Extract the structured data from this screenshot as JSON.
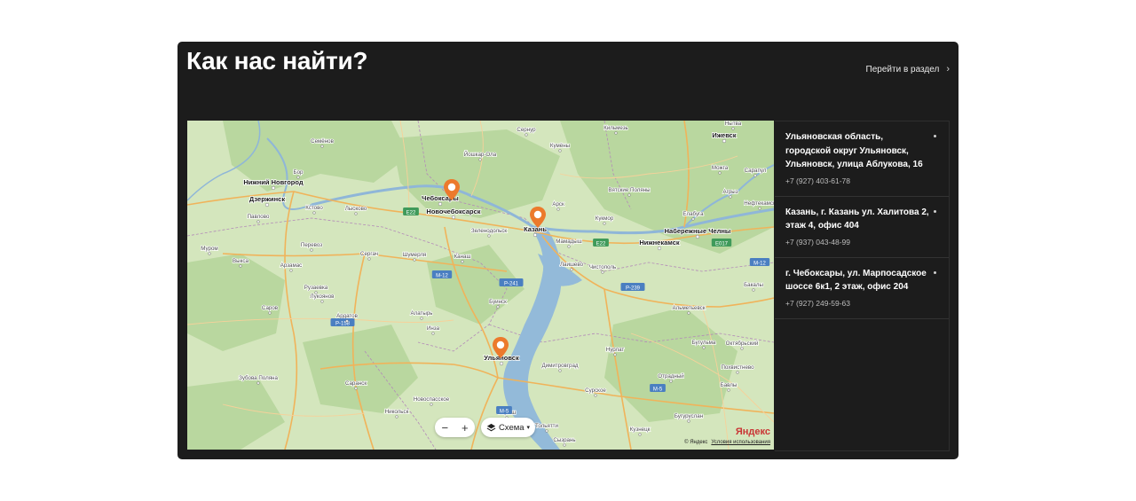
{
  "section": {
    "title": "Как нас найти?",
    "goto_label": "Перейти в раздел",
    "goto_icon": "chevron-right-icon"
  },
  "map": {
    "cities": [
      {
        "name": "Нижний Новгород",
        "bold": true
      },
      {
        "name": "Чебоксары",
        "bold": true
      },
      {
        "name": "Казань",
        "bold": true
      },
      {
        "name": "Ульяновск",
        "bold": true
      },
      {
        "name": "Набережные Челны",
        "bold": true
      },
      {
        "name": "Нижнекамск",
        "bold": true
      },
      {
        "name": "Ижевск",
        "bold": true
      },
      {
        "name": "Дзержинск",
        "bold": true
      },
      {
        "name": "Новочебоксарск",
        "bold": true
      },
      {
        "name": "Йошкар-Ола",
        "bold": false
      },
      {
        "name": "Муром",
        "bold": false
      },
      {
        "name": "Арзамас",
        "bold": false
      },
      {
        "name": "Саранск",
        "bold": false
      },
      {
        "name": "Димитровград",
        "bold": false
      },
      {
        "name": "Альметьевск",
        "bold": false
      },
      {
        "name": "Октябрьский",
        "bold": false
      },
      {
        "name": "Тольятти",
        "bold": false
      },
      {
        "name": "Новоспасское",
        "bold": false
      },
      {
        "name": "Бугульма",
        "bold": false
      },
      {
        "name": "Бугуруслан",
        "bold": false
      },
      {
        "name": "Чистополь",
        "bold": false
      },
      {
        "name": "Зеленодольск",
        "bold": false
      },
      {
        "name": "Сарапул",
        "bold": false
      },
      {
        "name": "Семёнов",
        "bold": false
      },
      {
        "name": "Сергач",
        "bold": false
      },
      {
        "name": "Саров",
        "bold": false
      },
      {
        "name": "Шумерля",
        "bold": false
      },
      {
        "name": "Канаш",
        "bold": false
      },
      {
        "name": "Алатырь",
        "bold": false
      },
      {
        "name": "Буинск",
        "bold": false
      },
      {
        "name": "Нурлат",
        "bold": false
      },
      {
        "name": "Сызрань",
        "bold": false
      },
      {
        "name": "Барыш",
        "bold": false
      },
      {
        "name": "Сурское",
        "bold": false
      },
      {
        "name": "Кузнецк",
        "bold": false
      },
      {
        "name": "Похвистнево",
        "bold": false
      },
      {
        "name": "Отрадный",
        "bold": false
      },
      {
        "name": "Бавлы",
        "bold": false
      },
      {
        "name": "Бакалы",
        "bold": false
      },
      {
        "name": "Агрыз",
        "bold": false
      },
      {
        "name": "Елабуга",
        "bold": false
      },
      {
        "name": "Мамадыш",
        "bold": false
      },
      {
        "name": "Арск",
        "bold": false
      },
      {
        "name": "Лаишево",
        "bold": false
      },
      {
        "name": "Сернур",
        "bold": false
      },
      {
        "name": "Кильмезь",
        "bold": false
      },
      {
        "name": "Вятские Поляны",
        "bold": false
      },
      {
        "name": "Кукмор",
        "bold": false
      },
      {
        "name": "Можга",
        "bold": false
      },
      {
        "name": "Лысково",
        "bold": false
      },
      {
        "name": "Кстово",
        "bold": false
      },
      {
        "name": "Бор",
        "bold": false
      },
      {
        "name": "Павлово",
        "bold": false
      },
      {
        "name": "Выкса",
        "bold": false
      },
      {
        "name": "Перевоз",
        "bold": false
      },
      {
        "name": "Лукоянов",
        "bold": false
      },
      {
        "name": "Ардатов",
        "bold": false
      },
      {
        "name": "Инза",
        "bold": false
      },
      {
        "name": "Никольск",
        "bold": false
      },
      {
        "name": "Рузаевка",
        "bold": false
      },
      {
        "name": "Зубова Поляна",
        "bold": false
      },
      {
        "name": "Нефтекамск",
        "bold": false
      },
      {
        "name": "Нытва",
        "bold": false
      },
      {
        "name": "Кумёны",
        "bold": false
      }
    ],
    "roads": [
      "E22",
      "E22",
      "E017",
      "M-12",
      "M-12",
      "P-241",
      "P-239",
      "P-158",
      "M-5",
      "M-5"
    ],
    "zoom_out": "−",
    "zoom_in": "+",
    "layer_label": "Схема",
    "layer_caret": "▾",
    "layer_icon": "layers-icon",
    "copyright": "© Яндекс",
    "terms": "Условия использования",
    "logo": "Яндекс"
  },
  "addresses": [
    {
      "title": "Ульяновская область, городской округ Ульяновск, Ульяновск, улица Аблукова, 16",
      "phone": "+7 (927) 403-61-78"
    },
    {
      "title": "Казань, г. Казань ул. Халитова 2, этаж 4, офис 404",
      "phone": "+7 (937) 043-48-99"
    },
    {
      "title": "г. Чебоксары, ул. Марпосадское шоссе 6к1, 2 этаж, офис 204",
      "phone": "+7 (927) 249-59-63"
    }
  ],
  "colors": {
    "panel_bg": "#1c1c1c",
    "map_land": "#cfe3b7",
    "forest": "#b5d49a",
    "water": "#8fb6d8",
    "road": "#f0b35a",
    "pin": "#ec7a2c"
  }
}
